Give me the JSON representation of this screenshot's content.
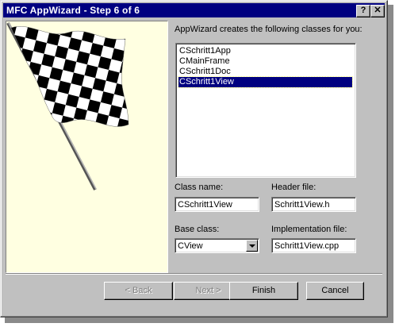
{
  "window": {
    "title": "MFC AppWizard - Step 6 of 6",
    "help_label": "?",
    "close_label": "✕"
  },
  "intro": "AppWizard creates the following classes for you:",
  "classes": [
    "CSchritt1App",
    "CMainFrame",
    "CSchritt1Doc",
    "CSchritt1View"
  ],
  "selected_class_index": 3,
  "fields": {
    "class_name_label": "Class name:",
    "class_name_value": "CSchritt1View",
    "header_file_label": "Header file:",
    "header_file_value": "Schritt1View.h",
    "base_class_label": "Base class:",
    "base_class_value": "CView",
    "impl_file_label": "Implementation file:",
    "impl_file_value": "Schritt1View.cpp"
  },
  "buttons": {
    "back": "< Back",
    "next": "Next >",
    "finish": "Finish",
    "cancel": "Cancel"
  },
  "colors": {
    "titlebar": "#000080",
    "panel": "#ffffe1",
    "face": "#c0c0c0",
    "selection": "#000080"
  }
}
